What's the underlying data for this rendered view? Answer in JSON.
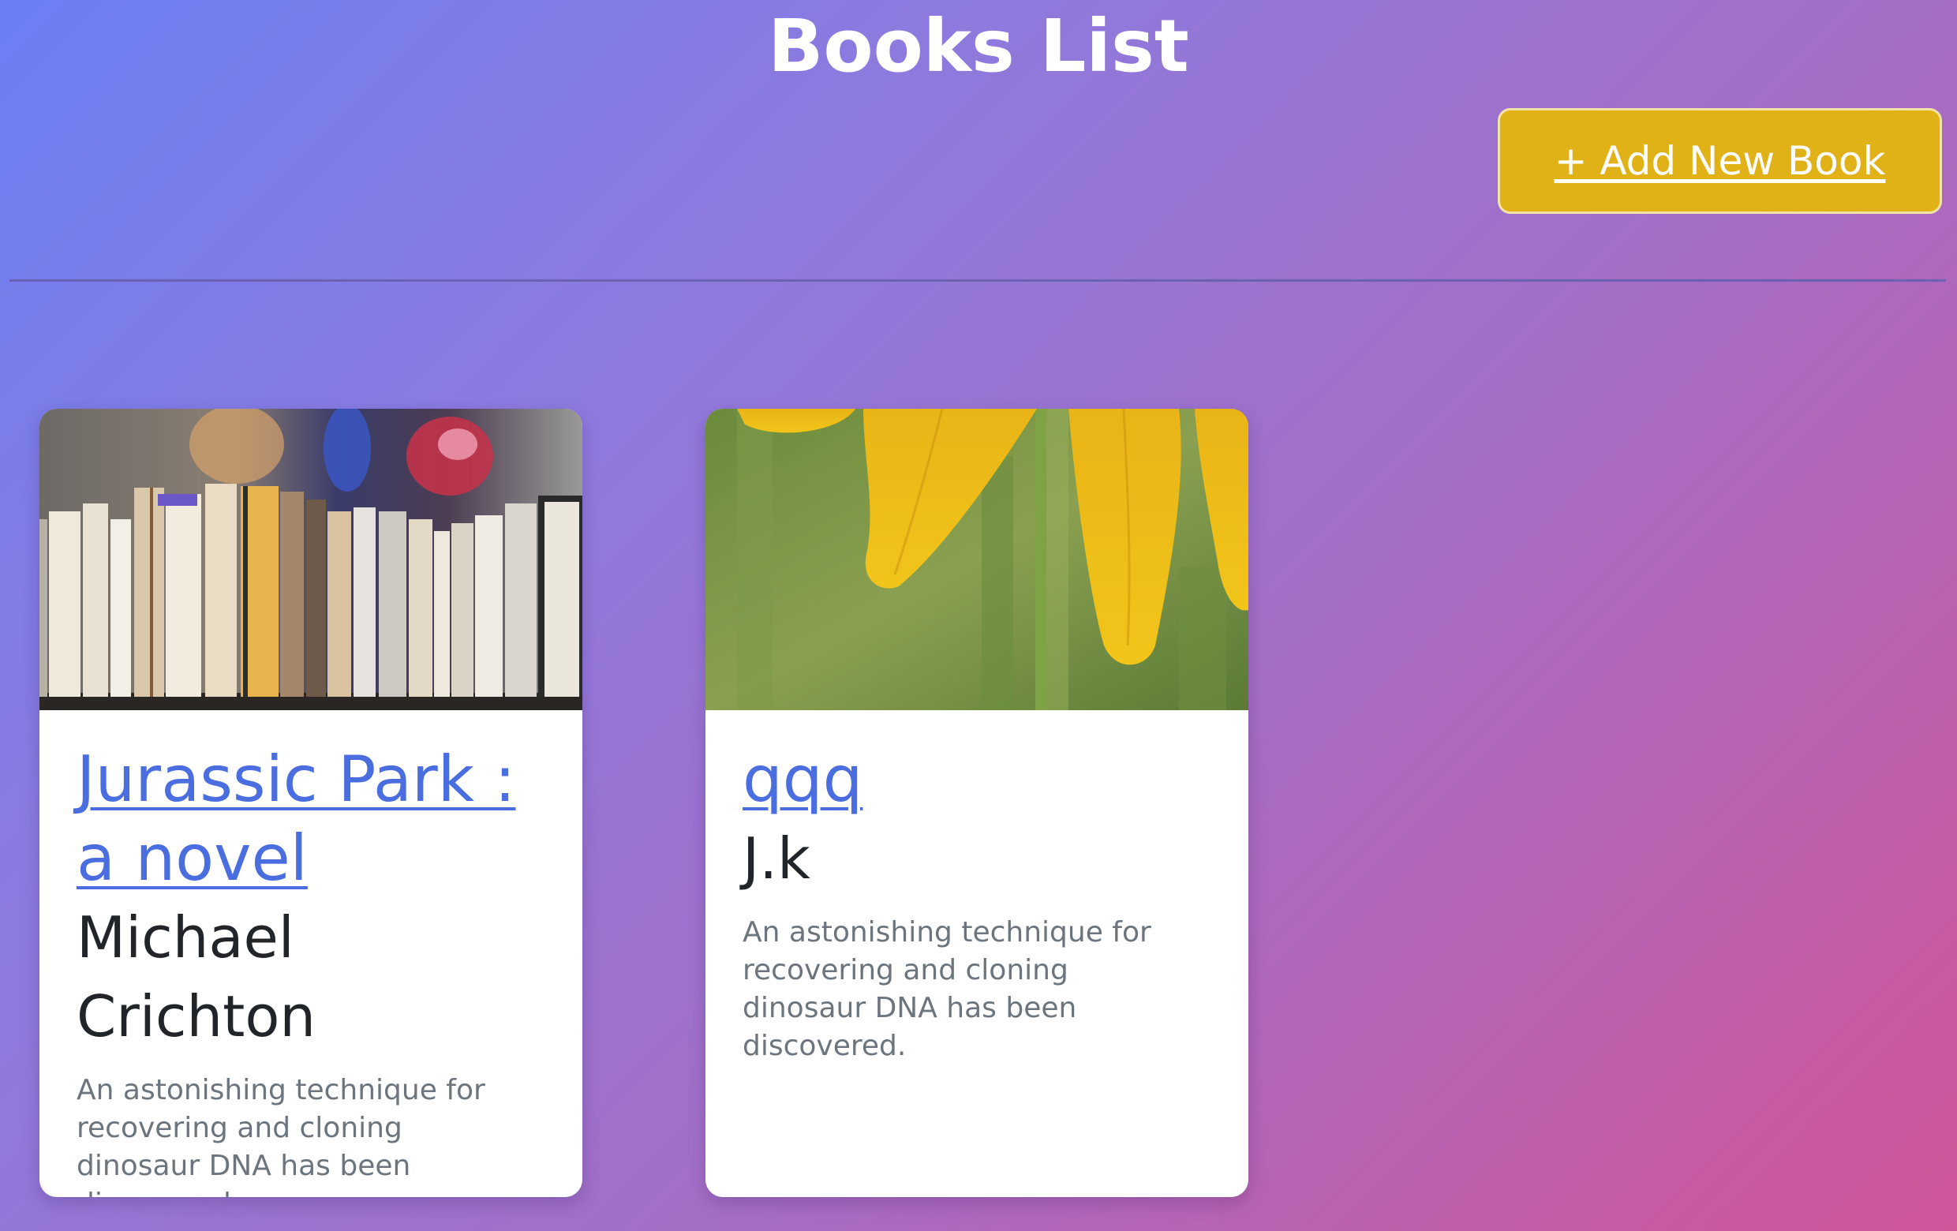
{
  "header": {
    "title": "Books List",
    "add_button_label": "+ Add New Book"
  },
  "colors": {
    "accent_button": "#e0b218",
    "link": "#4a6ee0",
    "gradient_start": "#6b7ff3",
    "gradient_end": "#d05498"
  },
  "books": [
    {
      "title": "Jurassic Park : a novel",
      "author": "Michael Crichton",
      "description": "An astonishing technique for recovering and cloning dinosaur DNA has been discovered.",
      "image": "bookshelf-photo"
    },
    {
      "title": "qqq",
      "author": "J.k",
      "description": "An astonishing technique for recovering and cloning dinosaur DNA has been discovered.",
      "image": "yellow-flower-photo"
    }
  ]
}
